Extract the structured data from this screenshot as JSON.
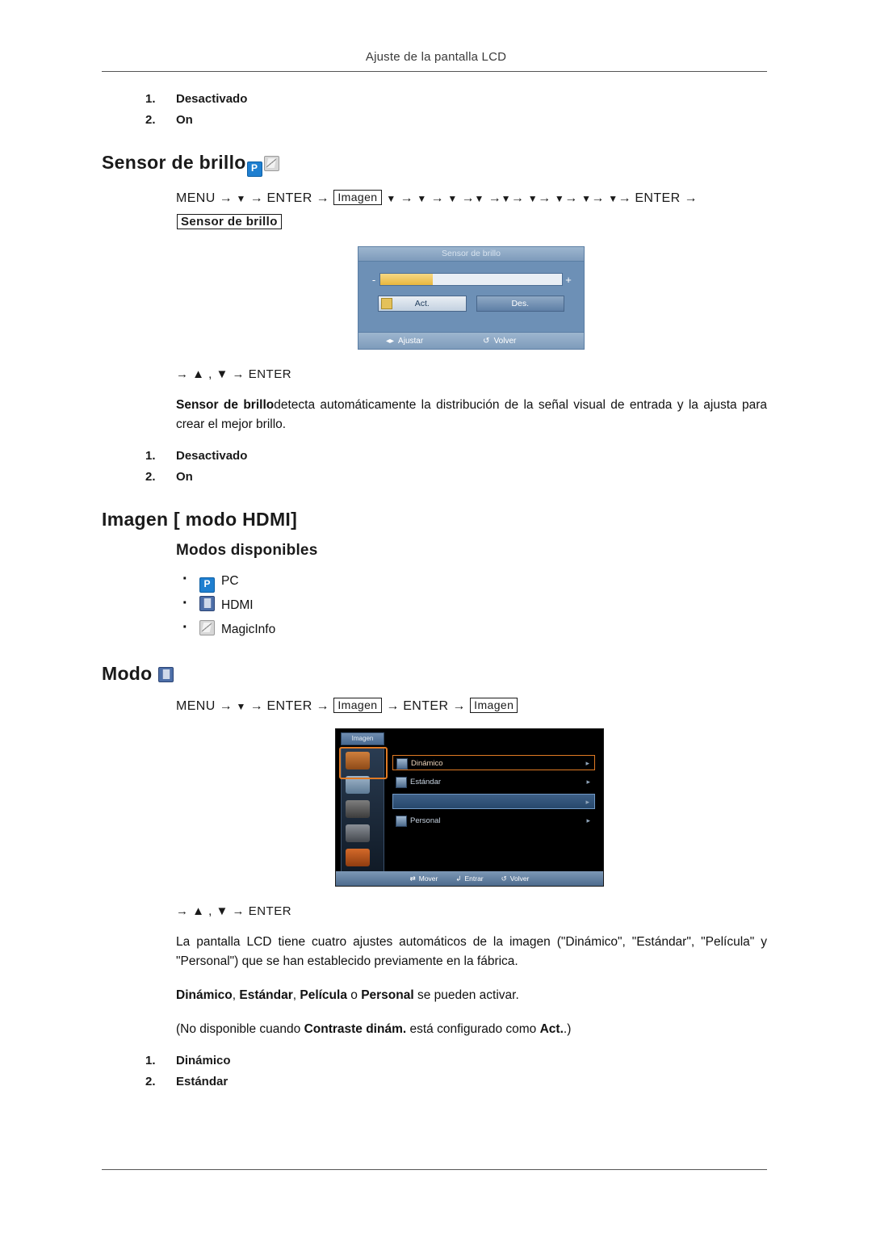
{
  "page": {
    "header": "Ajuste de la pantalla LCD"
  },
  "top_options": {
    "items": [
      {
        "num": "1.",
        "label": "Desactivado"
      },
      {
        "num": "2.",
        "label": "On"
      }
    ]
  },
  "brightness_sensor": {
    "heading": "Sensor de brillo",
    "icons": [
      "pc-badge-icon",
      "magicinfo-badge-icon"
    ],
    "menu_path": {
      "start": "MENU",
      "tokens": [
        "MENU",
        "▼",
        "ENTER",
        "Imagen",
        "▼",
        "▼",
        "▼",
        "▼",
        "▼",
        "▼",
        "▼",
        "▼",
        "▼",
        "▼",
        "ENTER"
      ],
      "boxed_1": "Imagen",
      "boxed_2": "Sensor de brillo",
      "enter": "ENTER"
    },
    "nav_line": "→ ▲ , ▼ → ENTER",
    "description_bold": "Sensor de brillo",
    "description_rest": "detecta automáticamente la distribución de la señal visual de entrada y la ajusta para crear el mejor brillo.",
    "options": [
      {
        "num": "1.",
        "label": "Desactivado"
      },
      {
        "num": "2.",
        "label": "On"
      }
    ],
    "osd": {
      "title": "Sensor de brillo",
      "minus": "-",
      "plus": "+",
      "slider_fill_percent": 29,
      "button_on": "Act.",
      "button_off": "Des.",
      "footer_adjust": "Ajustar",
      "footer_back": "Volver"
    }
  },
  "image_hdmi": {
    "heading": "Imagen [ modo HDMI]",
    "subheading": "Modos disponibles",
    "modes": [
      {
        "icon": "pc-badge-icon",
        "label": "PC"
      },
      {
        "icon": "hdmi-badge-icon",
        "label": "HDMI"
      },
      {
        "icon": "magicinfo-badge-icon",
        "label": "MagicInfo"
      }
    ]
  },
  "mode": {
    "heading": "Modo",
    "icon": "hdmi-badge-icon",
    "menu_path": {
      "t1": "MENU",
      "t2": "▼",
      "t3": "ENTER",
      "boxed_1": "Imagen",
      "t4": "ENTER",
      "boxed_2": "Imagen"
    },
    "nav_line": "→ ▲ , ▼ → ENTER",
    "paragraph_1": "La pantalla LCD tiene cuatro ajustes automáticos de la imagen (\"Dinámico\", \"Estándar\", \"Película\" y \"Personal\") que se han establecido previamente en la fábrica.",
    "paragraph_2_parts": {
      "b1": "Dinámico",
      "s1": ", ",
      "b2": "Estándar",
      "s2": ", ",
      "b3": "Película",
      "s3": " o ",
      "b4": "Personal",
      "s4": " se pueden activar."
    },
    "paragraph_3_parts": {
      "pre": "(No disponible cuando ",
      "b1": "Contraste dinám.",
      "mid": " está configurado como ",
      "b2": "Act.",
      "post": ".)"
    },
    "options": [
      {
        "num": "1.",
        "label": "Dinámico"
      },
      {
        "num": "2.",
        "label": "Estándar"
      }
    ],
    "osd": {
      "tab": "Imagen",
      "rows": [
        {
          "label": "Dinámico",
          "arrow": "▸"
        },
        {
          "label": "Estándar",
          "arrow": "▸"
        },
        {
          "label": "",
          "arrow": "▸"
        },
        {
          "label": "Personal",
          "arrow": "▸"
        }
      ],
      "footer": [
        {
          "glyph": "⇄",
          "label": "Mover"
        },
        {
          "glyph": "↲",
          "label": "Entrar"
        },
        {
          "glyph": "↺",
          "label": "Volver"
        }
      ]
    }
  }
}
